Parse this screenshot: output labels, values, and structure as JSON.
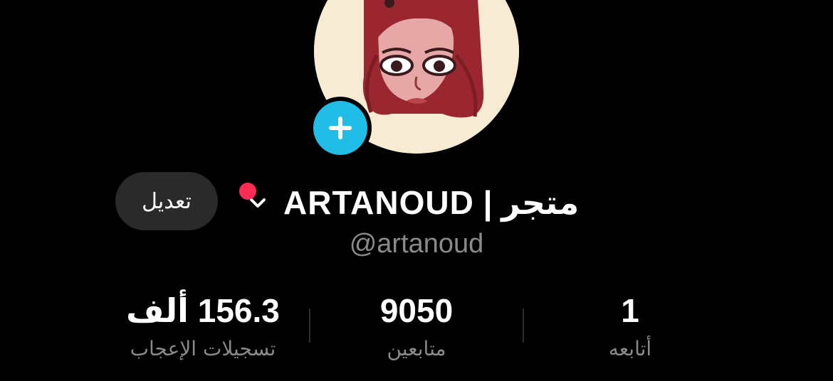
{
  "profile": {
    "display_name": "متجر | ARTANOUD",
    "username": "@artanoud",
    "edit_label": "تعديل",
    "avatar_icon": "illustrated-girl-avatar",
    "add_icon": "plus-icon",
    "switch_icon": "chevron-down-icon",
    "notification_dot_color": "#fe2c55",
    "add_button_color": "#21bde6"
  },
  "stats": {
    "likes": {
      "value": "156.3 ألف",
      "label": "تسجيلات الإعجاب"
    },
    "followers": {
      "value": "9050",
      "label": "متابعين"
    },
    "following": {
      "value": "1",
      "label": "أتابعه"
    }
  }
}
